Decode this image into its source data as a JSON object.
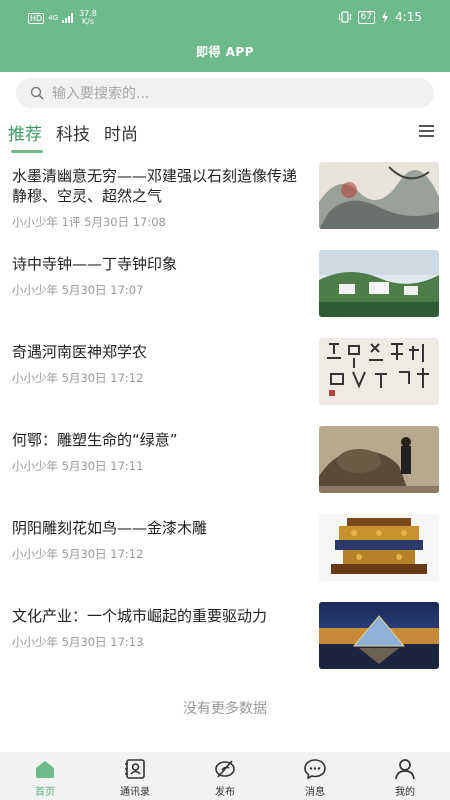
{
  "status": {
    "network": "4G",
    "hd": "HD",
    "speed_value": "37.8",
    "speed_unit": "K/s",
    "battery": "67",
    "time": "4:15"
  },
  "app": {
    "title": "即得 APP"
  },
  "search": {
    "placeholder": "输入要搜索的..."
  },
  "tabs": [
    {
      "label": "推荐"
    },
    {
      "label": "科技"
    },
    {
      "label": "时尚"
    }
  ],
  "articles": [
    {
      "title": "水墨清幽意无穷——邓建强以石刻造像传递静穆、空灵、超然之气",
      "meta": "小小少年 1评 5月30日 17:08",
      "image": "ink-landscape-painting"
    },
    {
      "title": "诗中寺钟——丁寺钟印象",
      "meta": "小小少年 5月30日 17:07",
      "image": "watercolor-village"
    },
    {
      "title": "奇遇河南医神郑学农",
      "meta": "小小少年 5月30日 17:12",
      "image": "calligraphy-scroll"
    },
    {
      "title": "何鄂：雕塑生命的“绿意”",
      "meta": "小小少年 5月30日 17:11",
      "image": "sculptor-at-work"
    },
    {
      "title": "阴阳雕刻花如鸟——金漆木雕",
      "meta": "小小少年 5月30日 17:12",
      "image": "gold-lacquer-woodcarving"
    },
    {
      "title": "文化产业：一个城市崛起的重要驱动力",
      "meta": "小小少年 5月30日 17:13",
      "image": "louvre-pyramid-night"
    }
  ],
  "footer": {
    "no_more": "没有更多数据"
  },
  "nav": [
    {
      "label": "首页",
      "icon": "home-icon"
    },
    {
      "label": "通讯录",
      "icon": "contacts-icon"
    },
    {
      "label": "发布",
      "icon": "publish-icon"
    },
    {
      "label": "消息",
      "icon": "message-icon"
    },
    {
      "label": "我的",
      "icon": "profile-icon"
    }
  ],
  "colors": {
    "accent": "#6fba8a",
    "active_tab": "#3b9b61",
    "tabbar_bg": "#f2f2f2"
  }
}
